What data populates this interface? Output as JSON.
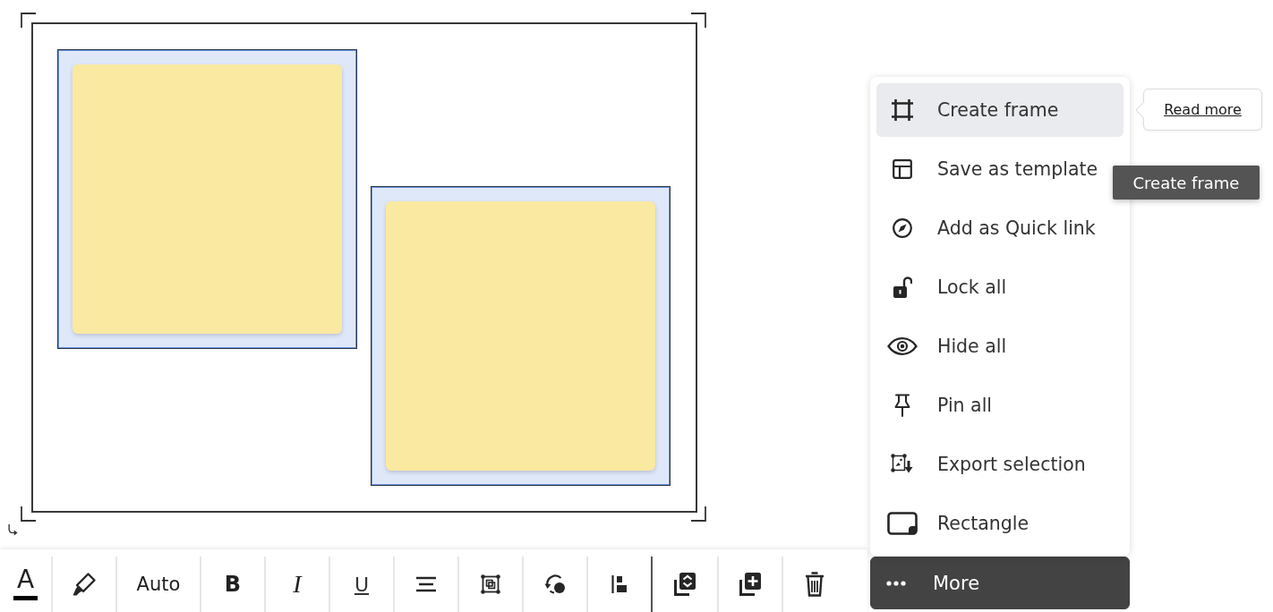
{
  "canvas": {
    "group_selected": true,
    "notes": [
      {
        "selected": true
      },
      {
        "selected": true
      }
    ]
  },
  "toolbar": {
    "items": [
      {
        "kind": "text-color",
        "label": "A"
      },
      {
        "kind": "icon"
      },
      {
        "kind": "text",
        "label": "Auto"
      },
      {
        "kind": "bold",
        "label": "B"
      },
      {
        "kind": "italic",
        "label": "I"
      },
      {
        "kind": "underline",
        "label": "U"
      },
      {
        "kind": "icon"
      },
      {
        "kind": "icon"
      },
      {
        "kind": "icon"
      },
      {
        "kind": "icon"
      },
      {
        "kind": "separator"
      },
      {
        "kind": "icon"
      },
      {
        "kind": "icon"
      },
      {
        "kind": "icon"
      }
    ],
    "more_button": {
      "label": "More",
      "expanded": true
    }
  },
  "menu": {
    "items": [
      {
        "label": "Create frame",
        "selected": true
      },
      {
        "label": "Save as template",
        "selected": false
      },
      {
        "label": "Add as Quick link",
        "selected": false
      },
      {
        "label": "Lock all",
        "selected": false
      },
      {
        "label": "Hide all",
        "selected": false
      },
      {
        "label": "Pin all",
        "selected": false
      },
      {
        "label": "Export selection",
        "selected": false
      },
      {
        "label": "Rectangle",
        "selected": false
      }
    ]
  },
  "popover": {
    "link": "Read more"
  },
  "tooltip": {
    "text": "Create frame"
  }
}
